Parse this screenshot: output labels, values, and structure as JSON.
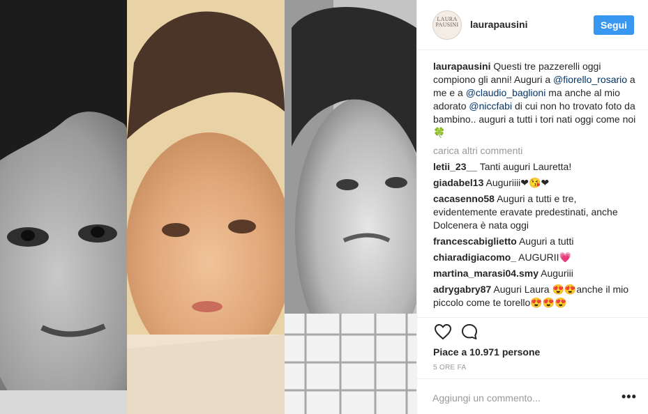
{
  "post": {
    "username": "laurapausini",
    "avatar_text": "LAURA PAUSINI",
    "follow_label": "Segui"
  },
  "caption": {
    "username": "laurapausini",
    "text_1": " Questi tre pazzerelli oggi compiono gli anni! Auguri a ",
    "mention_1": "@fiorello_rosario",
    "text_2": " a me e a ",
    "mention_2": "@claudio_baglioni",
    "text_3": " ma anche al mio adorato ",
    "mention_3": "@niccfabi",
    "text_4": " di cui non ho trovato foto da bambino.. auguri a tutti i tori nati oggi come noi 🍀"
  },
  "load_more": "carica altri commenti",
  "comments": [
    {
      "user": "letii_23__",
      "text": " Tanti auguri Lauretta!"
    },
    {
      "user": "giadabel13",
      "text": " Auguriiii❤😘❤"
    },
    {
      "user": "cacasenno58",
      "text": " Auguri a tutti e tre, evidentemente eravate predestinati, anche Dolcenera è nata oggi"
    },
    {
      "user": "francescabiglietto",
      "text": " Auguri a tutti"
    },
    {
      "user": "chiaradigiacomo_",
      "text": " AUGURII💗"
    },
    {
      "user": "martina_marasi04.smy",
      "text": " Auguriii"
    },
    {
      "user": "adrygabry87",
      "text": " Auguri Laura 😍😍anche il mio piccolo come te torello😍😍😍"
    },
    {
      "user": "",
      "text": ""
    }
  ],
  "likes": "Piace a 10.971 persone",
  "time": "5 ORE FA",
  "add_comment_placeholder": "Aggiungi un commento...",
  "more_options": "•••",
  "icons": [
    "heart-icon",
    "comment-icon"
  ],
  "colors": {
    "accent": "#3897f0",
    "mention": "#003569",
    "muted": "#999999"
  }
}
